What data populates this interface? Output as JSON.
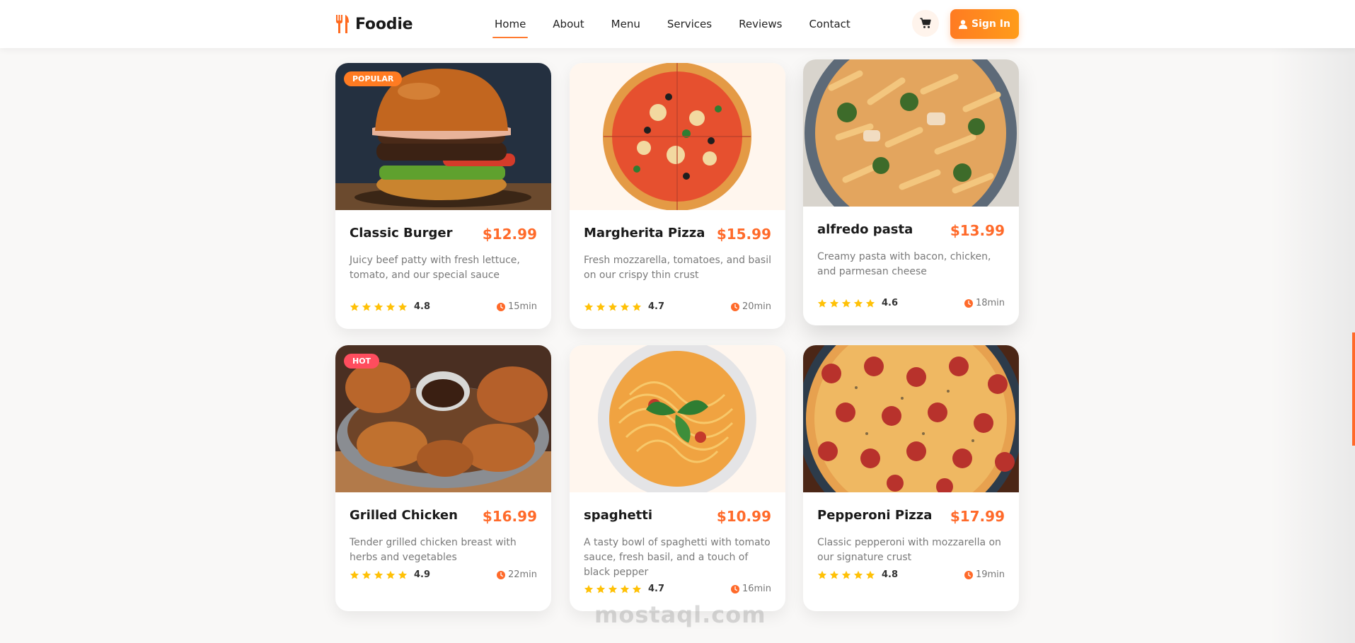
{
  "brand": {
    "name": "Foodie",
    "accent": "#ff7a2f"
  },
  "nav": {
    "links": [
      {
        "label": "Home",
        "active": true
      },
      {
        "label": "About",
        "active": false
      },
      {
        "label": "Menu",
        "active": false
      },
      {
        "label": "Services",
        "active": false
      },
      {
        "label": "Reviews",
        "active": false
      },
      {
        "label": "Contact",
        "active": false
      }
    ],
    "cart_icon": "cart-icon",
    "signin_label": "Sign In",
    "signin_icon": "user-icon"
  },
  "menu": {
    "cards": [
      {
        "name": "Classic Burger",
        "price": "$12.99",
        "description": "Juicy beef patty with fresh lettuce, tomato, and our special sauce",
        "rating": "4.8",
        "stars": 5,
        "time": "15min",
        "badge": "POPULAR"
      },
      {
        "name": "Margherita Pizza",
        "price": "$15.99",
        "description": "Fresh mozzarella, tomatoes, and basil on our crispy thin crust",
        "rating": "4.7",
        "stars": 5,
        "time": "20min",
        "badge": ""
      },
      {
        "name": "alfredo pasta",
        "price": "$13.99",
        "description": "Creamy pasta with bacon, chicken, and parmesan cheese",
        "rating": "4.6",
        "stars": 5,
        "time": "18min",
        "badge": ""
      },
      {
        "name": "Grilled Chicken",
        "price": "$16.99",
        "description": "Tender grilled chicken breast with herbs and vegetables",
        "rating": "4.9",
        "stars": 5,
        "time": "22min",
        "badge": "HOT"
      },
      {
        "name": "spaghetti",
        "price": "$10.99",
        "description": "A tasty bowl of spaghetti with tomato sauce, fresh basil, and a touch of black pepper",
        "rating": "4.7",
        "stars": 5,
        "time": "16min",
        "badge": ""
      },
      {
        "name": "Pepperoni Pizza",
        "price": "$17.99",
        "description": "Classic pepperoni with mozzarella on our signature crust",
        "rating": "4.8",
        "stars": 5,
        "time": "19min",
        "badge": ""
      }
    ]
  },
  "watermark": {
    "text": "mostaql.com"
  }
}
